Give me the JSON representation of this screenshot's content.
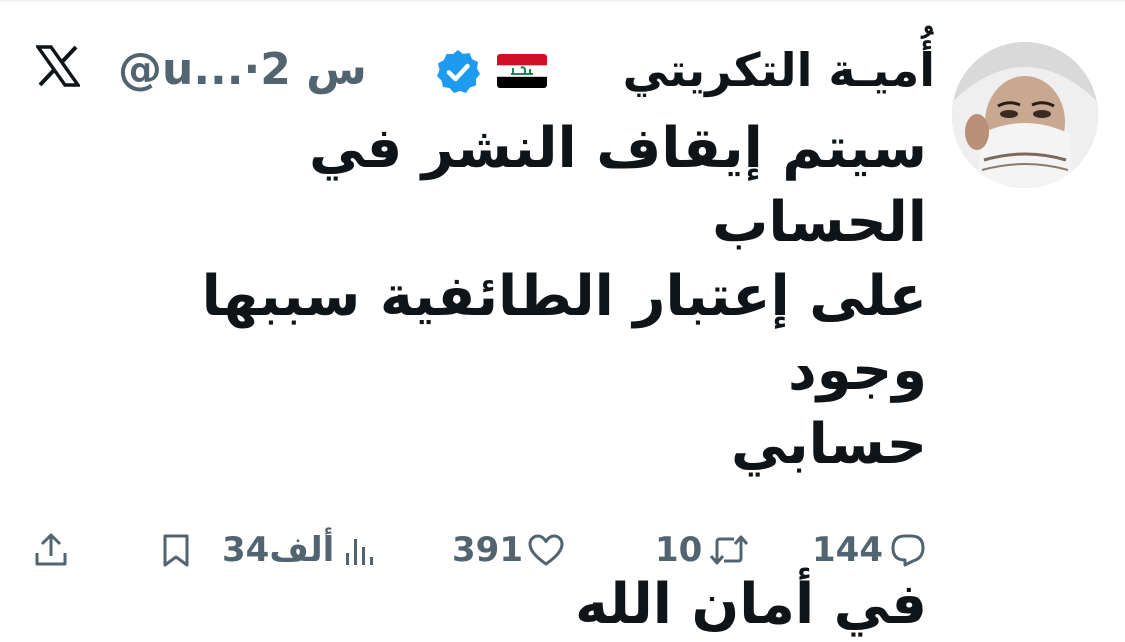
{
  "tweet": {
    "author": {
      "display_name": "أُميـة التكريتي",
      "flag": "iraq-flag",
      "verified": true,
      "handle_prefix": "@u...",
      "separator": "·",
      "time": "2 س"
    },
    "text_lines": [
      "سيتم إيقاف النشر في الحساب",
      "على إعتبار الطائفية سببها وجود",
      "حسابي"
    ],
    "closing_line": "في أمان الله",
    "actions": {
      "replies": "144",
      "reposts": "10",
      "likes": "391",
      "views": "34ألف"
    }
  },
  "icons": {
    "platform": "x-logo-icon",
    "verified": "verified-badge-icon",
    "reply": "reply-icon",
    "repost": "repost-icon",
    "like": "heart-icon",
    "views": "views-icon",
    "bookmark": "bookmark-icon",
    "share": "share-icon"
  },
  "colors": {
    "verified": "#1d9bf0",
    "text": "#0f1419",
    "secondary": "#536471"
  }
}
